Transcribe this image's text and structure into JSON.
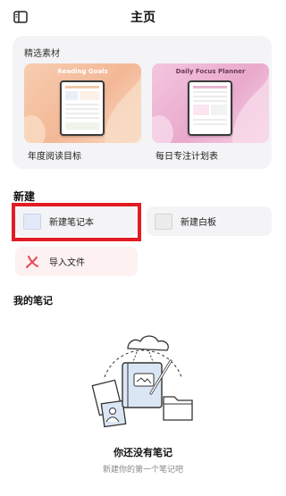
{
  "header": {
    "title": "主页",
    "sidebar_icon": "sidebar-toggle-icon"
  },
  "featured": {
    "label": "精选素材",
    "templates": [
      {
        "heading": "Reading Goals",
        "name": "年度阅读目标"
      },
      {
        "heading": "Daily Focus Planner",
        "name": "每日专注计划表"
      }
    ]
  },
  "create": {
    "label": "新建",
    "notebook_label": "新建笔记本",
    "whiteboard_label": "新建白板",
    "import_label": "导入文件"
  },
  "my_notes": {
    "label": "我的笔记",
    "empty_title": "你还没有笔记",
    "empty_subtitle": "新建你的第一个笔记吧"
  },
  "colors": {
    "highlight": "#e21b24",
    "card_bg": "#f4f4f6",
    "import_bg": "#fdf1f2",
    "pdf_red": "#e8455a"
  }
}
